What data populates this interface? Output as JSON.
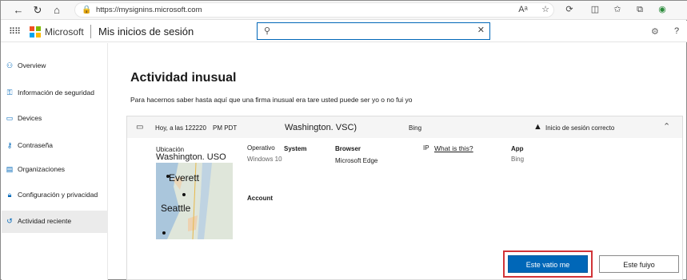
{
  "browser": {
    "url": "https://mysignins.microsoft.com"
  },
  "header": {
    "brand": "Microsoft",
    "app_title": "Mis inicios de sesión",
    "search_value": "",
    "brand_colors": [
      "#f25022",
      "#7fba00",
      "#00a4ef",
      "#ffb900"
    ],
    "accent": "#0067b8"
  },
  "sidebar": {
    "items": [
      {
        "label": "Overview",
        "icon": "user-icon"
      },
      {
        "label": "Información de seguridad",
        "icon": "key-user-icon"
      },
      {
        "label": "Devices",
        "icon": "laptop-icon"
      },
      {
        "label": "Contraseña",
        "icon": "key-icon"
      },
      {
        "label": "Organizaciones",
        "icon": "briefcase-icon"
      },
      {
        "label": "Configuración y privacidad",
        "icon": "lock-icon"
      },
      {
        "label": "Actividad reciente",
        "icon": "history-icon"
      }
    ],
    "active_index": 6
  },
  "main": {
    "title": "Actividad inusual",
    "description": "Para hacernos saber hasta aquí que una firma inusual era tare usted puede ser yo o no fui yo",
    "card": {
      "date": "Hoy, a las 122220",
      "time": "PM PDT",
      "location": "Washington. VSC)",
      "app": "Bing",
      "status": "Inicio de sesión correcto",
      "details": {
        "location_label": "Ubicación",
        "location_value": "Washington. USO",
        "os_label": "Operativo",
        "os_label_bold": "System",
        "os_value": "Windows 10",
        "browser_label": "Browser",
        "browser_value": "Microsoft Edge",
        "ip_label": "IP",
        "ip_link": "What is this?",
        "app_label": "App",
        "app_value": "Bing",
        "account_label": "Account"
      },
      "map": {
        "city_1": "Everett",
        "city_2": "Seattle"
      },
      "buttons": {
        "primary": "Este vatio      me",
        "secondary": "Este fuiyo"
      }
    }
  }
}
